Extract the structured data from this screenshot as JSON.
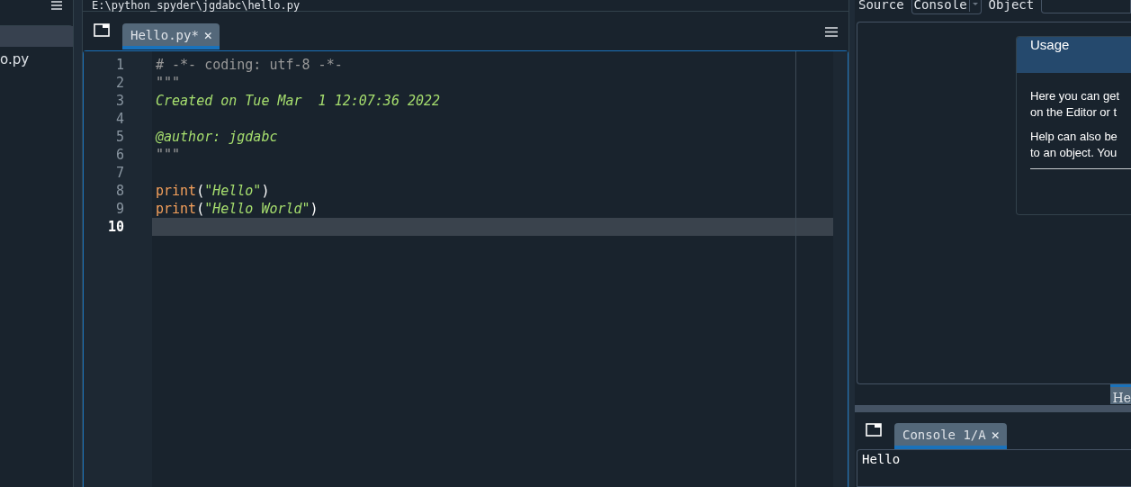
{
  "file_explorer": {
    "items": [
      {
        "selected": true
      },
      {
        "label": "o.py",
        "selected": false
      }
    ]
  },
  "editor": {
    "path": "E:\\python_spyder\\jgdabc\\hello.py",
    "tabs": [
      {
        "label": "Hello.py*",
        "close": "✕",
        "selected": true
      }
    ],
    "lines": [
      {
        "number": "1",
        "current": false,
        "tokens": [
          {
            "kind": "comment",
            "text": "# -*- coding: utf-8 -*-"
          }
        ]
      },
      {
        "number": "2",
        "current": false,
        "tokens": [
          {
            "kind": "comment",
            "text": "\"\"\""
          }
        ]
      },
      {
        "number": "3",
        "current": false,
        "tokens": [
          {
            "kind": "docstring",
            "text": "Created on Tue Mar  1 12:07:36 2022"
          }
        ]
      },
      {
        "number": "4",
        "current": false
      },
      {
        "number": "5",
        "current": false,
        "tokens": [
          {
            "kind": "docstring",
            "text": "@author: jgdabc"
          }
        ]
      },
      {
        "number": "6",
        "current": false,
        "tokens": [
          {
            "kind": "comment",
            "text": "\"\"\""
          }
        ]
      },
      {
        "number": "7",
        "current": false
      },
      {
        "number": "8",
        "current": false,
        "tokens": [
          {
            "kind": "builtin",
            "text": "print"
          },
          {
            "kind": "punct",
            "text": "("
          },
          {
            "kind": "string",
            "text": "\"Hello\""
          },
          {
            "kind": "punct",
            "text": ")"
          }
        ]
      },
      {
        "number": "9",
        "current": false,
        "tokens": [
          {
            "kind": "builtin",
            "text": "print"
          },
          {
            "kind": "punct",
            "text": "("
          },
          {
            "kind": "string",
            "text": "\"Hello World\""
          },
          {
            "kind": "punct",
            "text": ")"
          }
        ]
      },
      {
        "number": "10",
        "current": true
      }
    ]
  },
  "help": {
    "toolbar": {
      "source_label": "Source",
      "source_value": "Console",
      "object_label": "Object"
    },
    "usage": {
      "title": "Usage",
      "paragraphs": [
        [
          "Here you can get",
          "on the Editor or t"
        ],
        [
          "Help can also be",
          "to an object. You"
        ]
      ]
    },
    "tabs": [
      {
        "label": "He",
        "selected": true
      }
    ]
  },
  "console": {
    "tabs": [
      {
        "label": "Console 1/A",
        "close": "✕",
        "selected": true
      }
    ],
    "output": "Hello"
  }
}
